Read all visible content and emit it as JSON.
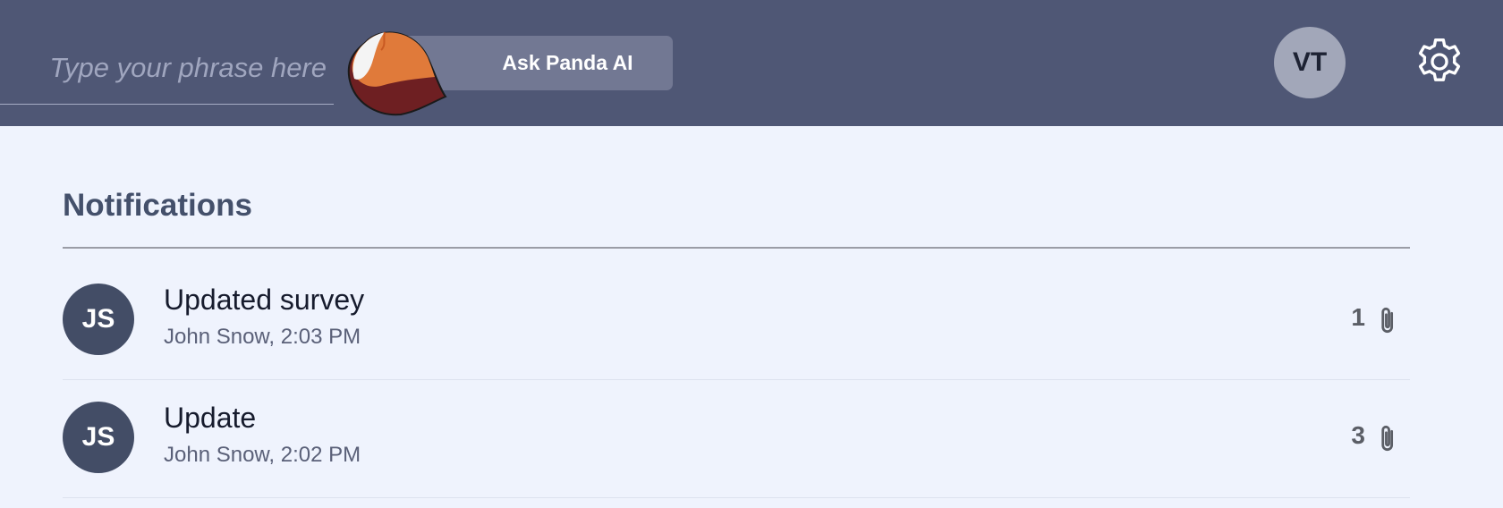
{
  "header": {
    "search": {
      "placeholder": "Type your phrase here",
      "value": ""
    },
    "ask_button_label": "Ask Panda AI",
    "logo_icon": "red-panda-tail-logo",
    "user_initials": "VT",
    "settings_icon": "gear-icon"
  },
  "notifications": {
    "title": "Notifications",
    "items": [
      {
        "initials": "JS",
        "title": "Updated survey",
        "meta": "John Snow, 2:03 PM",
        "attachments": "1",
        "attachment_icon": "paperclip-icon"
      },
      {
        "initials": "JS",
        "title": "Update",
        "meta": "John Snow, 2:02 PM",
        "attachments": "3",
        "attachment_icon": "paperclip-icon"
      }
    ]
  },
  "colors": {
    "topbar": "#4f5775",
    "page_background": "#eff3fd",
    "ask_button": "#727893",
    "user_avatar": "#a2a7b9",
    "row_avatar": "#434d66"
  }
}
